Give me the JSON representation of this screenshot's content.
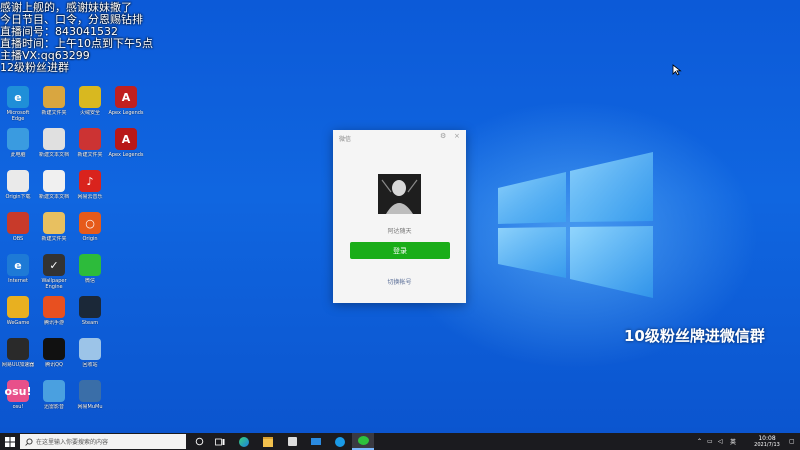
{
  "overlay_left": {
    "lines": [
      "感谢上舰的，感谢妹妹撒了",
      "今日节目、口令，分恩赐钻排",
      "直播间号：843041532",
      "直播时间：上午10点到下午5点",
      "主播VX:qq63299",
      "12级粉丝进群"
    ]
  },
  "overlay_right": {
    "text": "10级粉丝牌进微信群"
  },
  "desktop_icons": [
    {
      "label": "Microsoft Edge",
      "color": "#1f8fd8",
      "glyph": "e"
    },
    {
      "label": "新建文件夹",
      "color": "#d9a640",
      "glyph": ""
    },
    {
      "label": "火绒安全",
      "color": "#d8b820",
      "glyph": ""
    },
    {
      "label": "Apex Legends",
      "color": "#c02020",
      "glyph": "A"
    },
    {
      "label": "此电脑",
      "color": "#3a9be0",
      "glyph": ""
    },
    {
      "label": "新建文本文档",
      "color": "#e0e0e0",
      "glyph": ""
    },
    {
      "label": "新建文件夹",
      "color": "#cc3333",
      "glyph": ""
    },
    {
      "label": "Apex Legends",
      "color": "#b81818",
      "glyph": "A"
    },
    {
      "label": "Origin下载",
      "color": "#eaeaea",
      "glyph": ""
    },
    {
      "label": "新建文本文档",
      "color": "#f0f0f0",
      "glyph": ""
    },
    {
      "label": "网易云音乐",
      "color": "#d9231d",
      "glyph": "♪"
    },
    {
      "label": "OBS",
      "color": "#c83a2a",
      "glyph": ""
    },
    {
      "label": "新建文件夹",
      "color": "#e8c060",
      "glyph": ""
    },
    {
      "label": "Origin",
      "color": "#e65a1a",
      "glyph": "○"
    },
    {
      "label": "Internet",
      "color": "#1e7ad6",
      "glyph": "e"
    },
    {
      "label": "Wallpaper Engine",
      "color": "#333333",
      "glyph": "✓"
    },
    {
      "label": "微信",
      "color": "#2dbb3b",
      "glyph": ""
    },
    {
      "label": "WeGame",
      "color": "#e8b020",
      "glyph": ""
    },
    {
      "label": "腾讯手游",
      "color": "#e85020",
      "glyph": ""
    },
    {
      "label": "Steam",
      "color": "#1b2838",
      "glyph": ""
    },
    {
      "label": "网易UU加速器",
      "color": "#2a2a2a",
      "glyph": ""
    },
    {
      "label": "腾讯QQ",
      "color": "#111111",
      "glyph": ""
    },
    {
      "label": "回收站",
      "color": "#9cc4e8",
      "glyph": ""
    },
    {
      "label": "osu!",
      "color": "#e8508a",
      "glyph": "osu!"
    },
    {
      "label": "迅雷影音",
      "color": "#4aa0e0",
      "glyph": ""
    },
    {
      "label": "网易MuMu",
      "color": "#3a6ea8",
      "glyph": ""
    }
  ],
  "wechat": {
    "title": "微信",
    "username": "阿达随天",
    "login_label": "登录",
    "switch_label": "切换帐号"
  },
  "taskbar": {
    "search_placeholder": "在这里输入你要搜索的内容",
    "time": "10:08",
    "date": "2021/7/13",
    "ime": "英"
  }
}
